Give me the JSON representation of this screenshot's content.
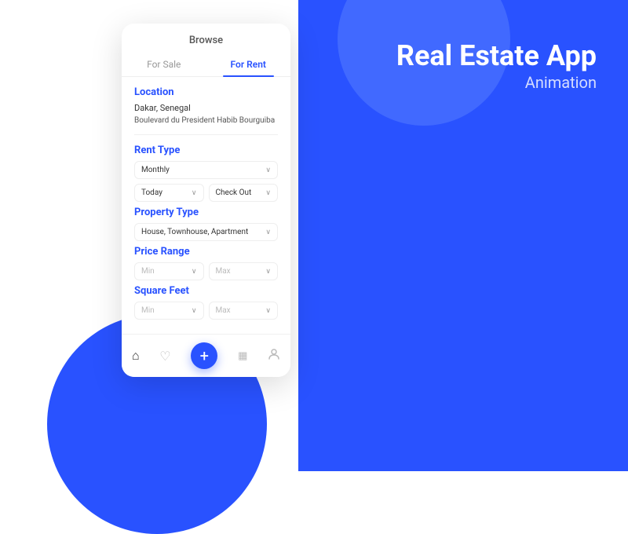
{
  "background": {
    "blue_color": "#2952FF"
  },
  "right_panel": {
    "title_line1": "Real Estate App",
    "title_line2": "Animation"
  },
  "phone": {
    "browse_label": "Browse",
    "tabs": [
      {
        "label": "For Sale",
        "active": false
      },
      {
        "label": "For Rent",
        "active": true
      }
    ],
    "location": {
      "section_label": "Location",
      "primary": "Dakar, Senegal",
      "secondary": "Boulevard du President Habib Bourguiba"
    },
    "rent_type": {
      "section_label": "Rent Type",
      "dropdown_value": "Monthly",
      "date_from": "Today",
      "date_to": "Check Out"
    },
    "property_type": {
      "section_label": "Property Type",
      "dropdown_value": "House, Townhouse, Apartment"
    },
    "price_range": {
      "section_label": "Price Range",
      "min_label": "Min",
      "max_label": "Max"
    },
    "square_feet": {
      "section_label": "Square Feet",
      "min_label": "Min",
      "max_label": "Max"
    },
    "nav": {
      "home_icon": "⌂",
      "heart_icon": "♡",
      "add_icon": "+",
      "calendar_icon": "▦",
      "user_icon": "○"
    }
  }
}
